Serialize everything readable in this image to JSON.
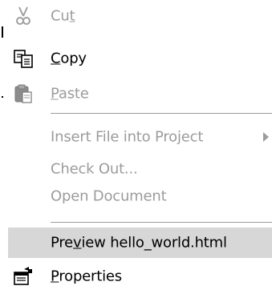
{
  "menu": {
    "items": [
      {
        "label": "Cut",
        "underline_index": 2,
        "enabled": false,
        "icon": "scissors-icon"
      },
      {
        "label": "Copy",
        "underline_index": 0,
        "enabled": true,
        "icon": "copy-icon"
      },
      {
        "label": "Paste",
        "underline_index": 0,
        "enabled": false,
        "icon": "paste-icon"
      },
      {
        "label": "Insert File into Project",
        "enabled": false,
        "has_submenu": true
      },
      {
        "label": "Check Out...",
        "enabled": false
      },
      {
        "label": "Open Document",
        "enabled": false
      },
      {
        "label": "Preview hello_world.html",
        "underline_index": 3,
        "enabled": true,
        "highlighted": true
      },
      {
        "label": "Properties",
        "underline_index": 0,
        "enabled": true,
        "icon": "properties-icon"
      }
    ]
  },
  "colors": {
    "disabled_text": "#9c9c9c",
    "highlight_bg": "#d7d7d7",
    "separator": "#9c9c9c"
  }
}
